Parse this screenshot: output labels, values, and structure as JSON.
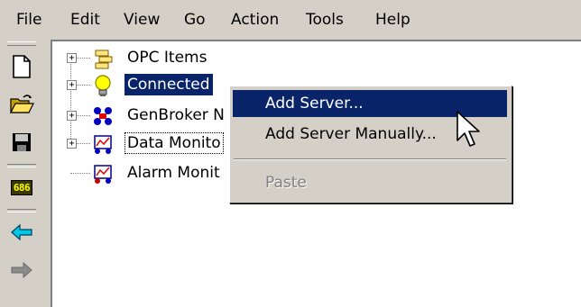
{
  "menubar": {
    "items": [
      "File",
      "Edit",
      "View",
      "Go",
      "Action",
      "Tools",
      "Help"
    ]
  },
  "toolbar": {
    "badge_text": "686",
    "icons": [
      "new-document-icon",
      "open-folder-icon",
      "save-icon",
      "counter-686-icon",
      "back-arrow-icon",
      "forward-arrow-icon"
    ]
  },
  "tree": {
    "items": [
      {
        "label": "OPC Items",
        "icon": "opc-items-icon",
        "expander": "+"
      },
      {
        "label": "Connected",
        "icon": "lightbulb-icon",
        "expander": "+",
        "selected": true
      },
      {
        "label": "GenBroker N",
        "icon": "genbroker-icon",
        "expander": "+"
      },
      {
        "label": "Data Monito",
        "icon": "data-monitor-icon",
        "expander": "+",
        "focused": true
      },
      {
        "label": "Alarm Monit",
        "icon": "alarm-monitor-icon",
        "expander": ""
      }
    ]
  },
  "context_menu": {
    "items": [
      {
        "label": "Add Server...",
        "state": "highlighted"
      },
      {
        "label": "Add Server Manually...",
        "state": "normal"
      },
      {
        "label": "Paste",
        "state": "disabled"
      }
    ]
  },
  "colors": {
    "chrome": "#d4d0c8",
    "selection": "#0a246a",
    "disabled_text": "#808080"
  }
}
